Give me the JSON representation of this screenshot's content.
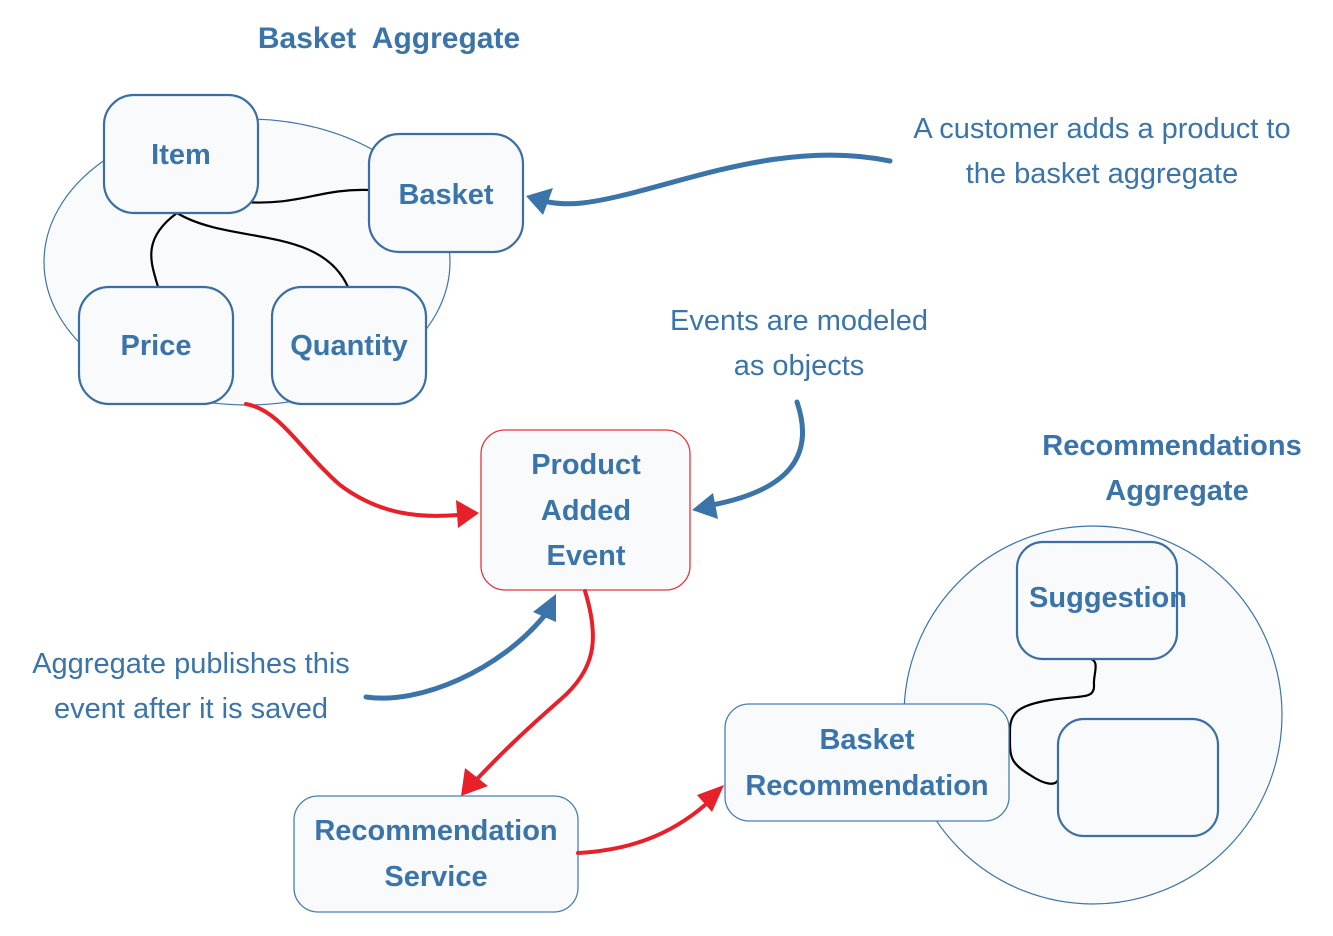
{
  "diagram": {
    "colors": {
      "text": "#3b74a8",
      "node_border": "#3b6fa3",
      "node_fill": "#f8fafc",
      "event_border": "#e8343c",
      "flow_arrow": "#e8202a",
      "annotation_arrow": "#3b74a8",
      "association_line": "#000000"
    },
    "aggregates": {
      "basket": {
        "title": "Basket  Aggregate",
        "nodes": {
          "item": "Item",
          "basket": "Basket",
          "price": "Price",
          "quantity": "Quantity"
        }
      },
      "recommendations": {
        "title_line1": "Recommendations",
        "title_line2": "Aggregate",
        "nodes": {
          "suggestion": "Suggestion",
          "unnamed": ""
        }
      }
    },
    "event": {
      "line1": "Product",
      "line2": "Added",
      "line3": "Event"
    },
    "service": {
      "line1": "Recommendation",
      "line2": "Service"
    },
    "basket_recommendation": {
      "line1": "Basket",
      "line2": "Recommendation"
    },
    "annotations": {
      "customer_adds": {
        "line1": "A customer adds a product to",
        "line2": "the basket aggregate"
      },
      "events_modeled": {
        "line1": "Events are modeled",
        "line2": "as objects"
      },
      "aggregate_publishes": {
        "line1": "Aggregate publishes this",
        "line2": "event after it is saved"
      }
    },
    "connections": [
      {
        "from": "Price/Quantity (Basket Aggregate)",
        "to": "Product Added Event",
        "kind": "flow"
      },
      {
        "from": "Product Added Event",
        "to": "Recommendation Service",
        "kind": "flow"
      },
      {
        "from": "Recommendation Service",
        "to": "Basket Recommendation",
        "kind": "flow"
      },
      {
        "from": "A customer adds a product to the basket aggregate",
        "to": "Basket",
        "kind": "annotation"
      },
      {
        "from": "Events are modeled as objects",
        "to": "Product Added Event",
        "kind": "annotation"
      },
      {
        "from": "Aggregate publishes this event after it is saved",
        "to": "Product Added Event",
        "kind": "annotation"
      },
      {
        "from": "Item",
        "to": "Basket",
        "kind": "association"
      },
      {
        "from": "Item",
        "to": "Price",
        "kind": "association"
      },
      {
        "from": "Item",
        "to": "Quantity",
        "kind": "association"
      },
      {
        "from": "Suggestion",
        "to": "Basket Recommendation",
        "kind": "association"
      },
      {
        "from": "Basket Recommendation",
        "to": "unnamed box",
        "kind": "association"
      }
    ]
  }
}
